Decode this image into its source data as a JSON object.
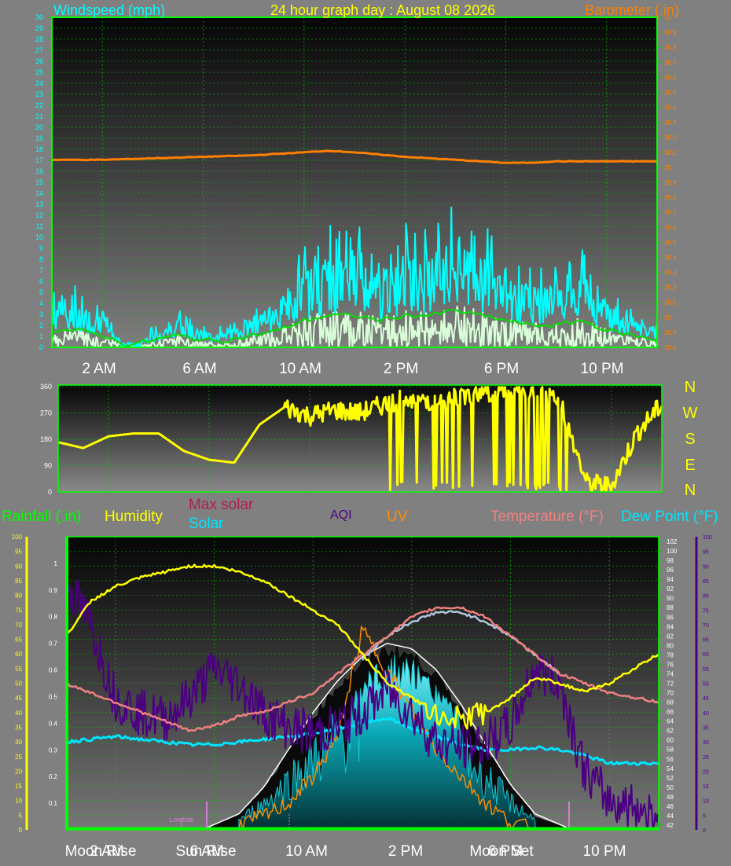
{
  "header": {
    "windspeed_label": "Windspeed (mph)",
    "title": "24 hour graph day : August 08 2026",
    "barometer_label": "Barometer (.in)"
  },
  "colors": {
    "background": "#808080",
    "grid": "#00d000",
    "wind": "#00ffff",
    "gust_avg": "#00e000",
    "wind_low": "#d8ffd8",
    "barometer": "#ff7f00",
    "direction": "#ffff00",
    "humidity": "#ffff00",
    "temperature": "#f08080",
    "dewpoint": "#b0c4de",
    "solar": "#00e5ff",
    "max_solar": "#ffffff",
    "aqi": "#4b0082",
    "uv": "#ff8c00",
    "rain": "#00ff00"
  },
  "time_labels": [
    "2 AM",
    "6 AM",
    "10 AM",
    "2 PM",
    "6 PM",
    "10 PM"
  ],
  "direction_panel": {
    "compass": [
      "N",
      "W",
      "S",
      "E",
      "N"
    ]
  },
  "bottom_panel": {
    "labels": {
      "rainfall": "Rainfall (.in)",
      "humidity": "Humidity",
      "max_solar": "Max solar",
      "solar": "Solar",
      "aqi": "AQI",
      "uv": "UV",
      "temperature": "Temperature (°F)",
      "dewpoint": "Dew Point (°F)"
    },
    "events": {
      "moon_rise": "Moon Rise",
      "sun_rise": "Sun Rise",
      "moon_set": "Moon Set",
      "lowtide": "Lowtide"
    }
  },
  "chart_data": [
    {
      "type": "line",
      "title": "24 hour graph day : August 08 2026",
      "x_range_hours": [
        0,
        24
      ],
      "x_ticks": [
        "2 AM",
        "6 AM",
        "10 AM",
        "2 PM",
        "6 PM",
        "10 PM"
      ],
      "left_axis": {
        "label": "Windspeed (mph)",
        "range": [
          0,
          30
        ],
        "ticks": [
          0,
          1,
          2,
          3,
          4,
          5,
          6,
          7,
          8,
          9,
          10,
          11,
          12,
          13,
          14,
          15,
          16,
          17,
          18,
          19,
          20,
          21,
          22,
          23,
          24,
          25,
          26,
          27,
          28,
          29,
          30
        ]
      },
      "right_axis": {
        "label": "Barometer (.in)",
        "range": [
          28.8,
          31
        ],
        "ticks": [
          "28.8",
          "28.9",
          "29",
          "29.1",
          "29.2",
          "29.3",
          "29.4",
          "29.5",
          "29.6",
          "29.7",
          "29.8",
          "29.9",
          "30",
          "30.1",
          "30.2",
          "30.3",
          "30.4",
          "30.5",
          "30.6",
          "30.7",
          "30.8",
          "30.9",
          "31"
        ]
      },
      "series": [
        {
          "name": "Windspeed (mph)",
          "x": [
            0,
            1,
            2,
            3,
            4,
            5,
            6,
            7,
            8,
            9,
            10,
            11,
            12,
            13,
            14,
            15,
            16,
            17,
            18,
            19,
            20,
            21,
            22,
            23,
            24
          ],
          "values": [
            3,
            3,
            2,
            0,
            1,
            2,
            1,
            1,
            2,
            3,
            5,
            6,
            6,
            5,
            6,
            6,
            7,
            6,
            5,
            4,
            4,
            5,
            3,
            2,
            1
          ]
        },
        {
          "name": "Barometer (.in)",
          "x": [
            0,
            2,
            4,
            6,
            8,
            10,
            11,
            12,
            14,
            16,
            17,
            18,
            19,
            20,
            22,
            24
          ],
          "values": [
            30.05,
            30.05,
            30.06,
            30.07,
            30.08,
            30.1,
            30.11,
            30.1,
            30.07,
            30.05,
            30.04,
            30.03,
            30.03,
            30.04,
            30.04,
            30.04
          ]
        }
      ]
    },
    {
      "type": "line",
      "y_range": [
        0,
        360
      ],
      "y_ticks": [
        0,
        90,
        180,
        270,
        360
      ],
      "series": [
        {
          "name": "Wind direction",
          "x": [
            0,
            1,
            2,
            3,
            4,
            5,
            6,
            7,
            8,
            9,
            10,
            11,
            12,
            13,
            14,
            15,
            16,
            17,
            18,
            19,
            20,
            21,
            22,
            23,
            24
          ],
          "values": [
            170,
            150,
            190,
            200,
            200,
            140,
            110,
            100,
            230,
            290,
            260,
            280,
            270,
            300,
            320,
            310,
            330,
            340,
            350,
            340,
            300,
            30,
            20,
            200,
            300
          ]
        }
      ]
    },
    {
      "type": "line",
      "left_axis": {
        "label": "Humidity",
        "range": [
          0,
          100
        ],
        "ticks": [
          0,
          5,
          10,
          15,
          20,
          25,
          30,
          35,
          40,
          45,
          50,
          55,
          60,
          65,
          70,
          75,
          80,
          85,
          90,
          95,
          100
        ]
      },
      "rain_axis": {
        "label": "Rainfall (.in)",
        "range": [
          0,
          1.1
        ],
        "ticks": [
          "0.1",
          "0.2",
          "0.3",
          "0.4",
          "0.5",
          "0.6",
          "0.7",
          "0.8",
          "0.9",
          "1"
        ]
      },
      "right_axis": {
        "label": "Temperature (°F)",
        "range": [
          41,
          103
        ],
        "ticks": [
          42,
          44,
          46,
          48,
          50,
          52,
          54,
          56,
          58,
          60,
          62,
          64,
          66,
          68,
          70,
          72,
          74,
          76,
          78,
          80,
          82,
          84,
          86,
          88,
          90,
          92,
          94,
          96,
          98,
          100,
          102
        ]
      },
      "aqi_axis": {
        "label": "AQI",
        "range": [
          0,
          100
        ],
        "ticks": [
          0,
          5,
          10,
          15,
          20,
          25,
          30,
          35,
          40,
          45,
          50,
          55,
          60,
          65,
          70,
          75,
          80,
          85,
          90,
          95,
          100
        ]
      },
      "series": [
        {
          "name": "Humidity",
          "x": [
            0,
            1,
            2,
            3,
            4,
            5,
            6,
            7,
            8,
            9,
            10,
            11,
            12,
            13,
            14,
            15,
            16,
            17,
            18,
            19,
            20,
            21,
            22,
            23,
            24
          ],
          "values": [
            66,
            78,
            83,
            86,
            88,
            90,
            90,
            88,
            85,
            80,
            75,
            70,
            60,
            50,
            45,
            40,
            38,
            40,
            45,
            52,
            50,
            47,
            50,
            55,
            60
          ]
        },
        {
          "name": "Temperature (°F)",
          "x": [
            0,
            1,
            2,
            3,
            4,
            5,
            6,
            7,
            8,
            9,
            10,
            11,
            12,
            13,
            14,
            15,
            16,
            17,
            18,
            19,
            20,
            21,
            22,
            23,
            24
          ],
          "values": [
            72,
            70,
            68,
            66,
            64,
            62,
            63,
            65,
            66,
            68,
            70,
            74,
            78,
            82,
            86,
            88,
            88,
            86,
            82,
            78,
            74,
            72,
            70,
            69,
            68
          ]
        },
        {
          "name": "Dew Point (°F)",
          "x": [
            12,
            13,
            14,
            15,
            16,
            17,
            18,
            19,
            20
          ],
          "values": [
            77,
            82,
            85,
            87,
            87,
            85,
            82,
            78,
            74
          ]
        },
        {
          "name": "Solar",
          "x": [
            0,
            1,
            2,
            3,
            4,
            5,
            6,
            7,
            8,
            9,
            10,
            11,
            12,
            13,
            14,
            15,
            16,
            17,
            18,
            19,
            20,
            21,
            22,
            23,
            24
          ],
          "values": [
            0.33,
            0.34,
            0.35,
            0.34,
            0.33,
            0.32,
            0.32,
            0.33,
            0.34,
            0.35,
            0.36,
            0.38,
            0.4,
            0.42,
            0.38,
            0.35,
            0.32,
            0.3,
            0.3,
            0.31,
            0.3,
            0.28,
            0.25,
            0.25,
            0.25
          ]
        },
        {
          "name": "Max solar",
          "x": [
            5.5,
            7,
            8,
            9,
            10,
            11,
            12,
            13,
            14,
            15,
            16,
            17,
            18,
            19,
            20.5
          ],
          "values": [
            0,
            0.06,
            0.16,
            0.3,
            0.44,
            0.56,
            0.65,
            0.7,
            0.68,
            0.6,
            0.47,
            0.32,
            0.17,
            0.06,
            0
          ]
        },
        {
          "name": "AQI",
          "x": [
            0,
            1,
            2,
            3,
            4,
            5,
            6,
            7,
            8,
            9,
            10,
            11,
            12,
            13,
            14,
            15,
            16,
            17,
            18,
            19,
            20,
            21,
            22,
            23,
            24
          ],
          "values": [
            85,
            70,
            45,
            40,
            38,
            45,
            55,
            50,
            40,
            35,
            33,
            35,
            40,
            48,
            40,
            30,
            28,
            30,
            35,
            55,
            50,
            20,
            10,
            8,
            5
          ]
        },
        {
          "name": "UV",
          "x": [
            7,
            8,
            9,
            10,
            11,
            11.5,
            12,
            13,
            14,
            15,
            16,
            17,
            18,
            19
          ],
          "values": [
            0.02,
            0.05,
            0.1,
            0.2,
            0.35,
            0.55,
            0.75,
            0.6,
            0.45,
            0.3,
            0.2,
            0.1,
            0.03,
            0
          ]
        }
      ]
    }
  ]
}
